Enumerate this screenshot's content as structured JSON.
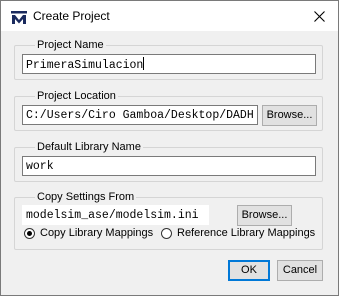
{
  "window": {
    "title": "Create Project",
    "app_icon": "modelsim-logo-icon",
    "close_icon": "close-icon"
  },
  "project_name": {
    "legend": "Project Name",
    "value": "PrimeraSimulacion"
  },
  "project_location": {
    "legend": "Project Location",
    "value": "C:/Users/Ciro Gamboa/Desktop/DADH",
    "browse_label": "Browse..."
  },
  "default_library": {
    "legend": "Default Library Name",
    "value": "work"
  },
  "copy_settings": {
    "legend": "Copy Settings From",
    "value": "modelsim_ase/modelsim.ini",
    "browse_label": "Browse...",
    "options": [
      {
        "label": "Copy Library Mappings",
        "selected": true
      },
      {
        "label": "Reference Library Mappings",
        "selected": false
      }
    ]
  },
  "buttons": {
    "ok_label": "OK",
    "cancel_label": "Cancel"
  },
  "colors": {
    "accent": "#0078d7",
    "logo": "#1a2a5e"
  }
}
